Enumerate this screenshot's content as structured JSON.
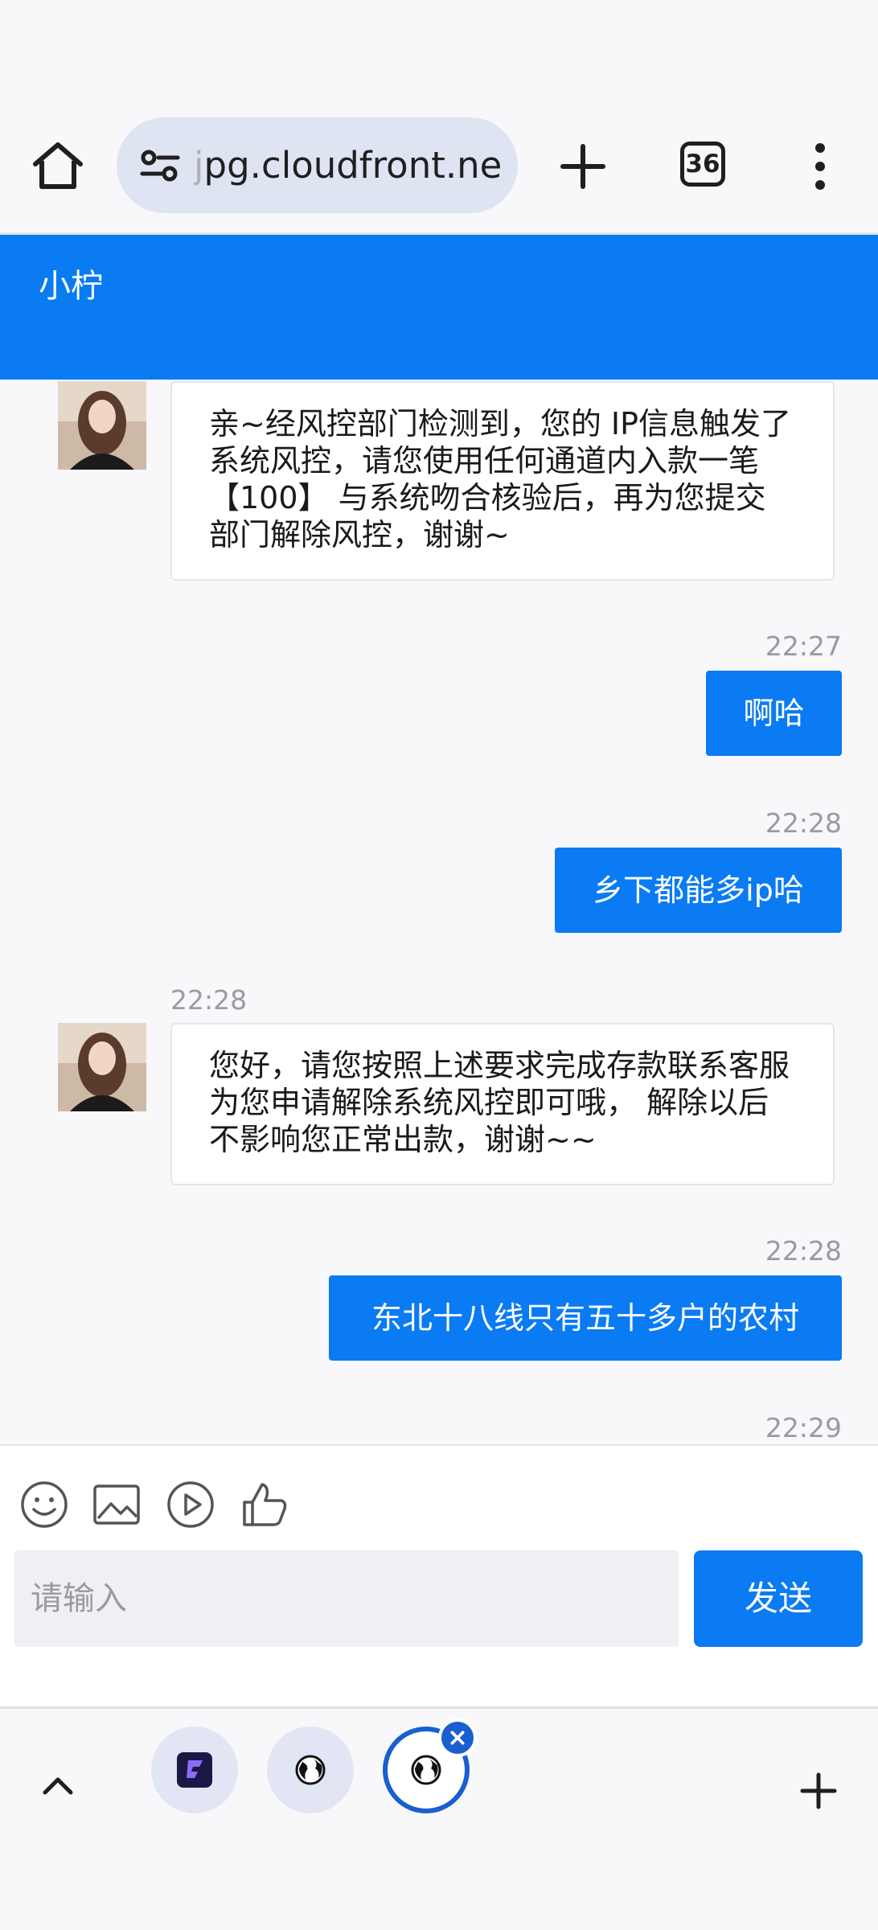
{
  "browser": {
    "url": "jpg.cloudfront.net",
    "url_faded_prefix": "j",
    "url_rest": "pg.cloudfront.net",
    "tab_count": "36"
  },
  "chat": {
    "title": "小柠",
    "messages": [
      {
        "side": "in",
        "text": "亲~经风控部门检测到，您的 IP信息触发了系统风控，请您使用任何通道内入款一笔 【100】 与系统吻合核验后，再为您提交部门解除风控，谢谢~"
      },
      {
        "side": "out",
        "time": "22:27",
        "text": "啊哈"
      },
      {
        "side": "out",
        "time": "22:28",
        "text": "乡下都能多ip哈"
      },
      {
        "side": "in",
        "time": "22:28",
        "text": "您好，请您按照上述要求完成存款联系客服为您申请解除系统风控即可哦， 解除以后不影响您正常出款，谢谢~~"
      },
      {
        "side": "out",
        "time": "22:28",
        "text": "东北十八线只有五十多户的农村"
      },
      {
        "side": "out",
        "time": "22:29",
        "text": ""
      }
    ]
  },
  "composer": {
    "placeholder": "请输入",
    "send_label": "发送",
    "tools": [
      "emoji-icon",
      "image-icon",
      "video-icon",
      "thumbs-up-icon"
    ]
  },
  "colors": {
    "brand": "#0a7bf2",
    "active_tab": "#1a5fd0"
  }
}
